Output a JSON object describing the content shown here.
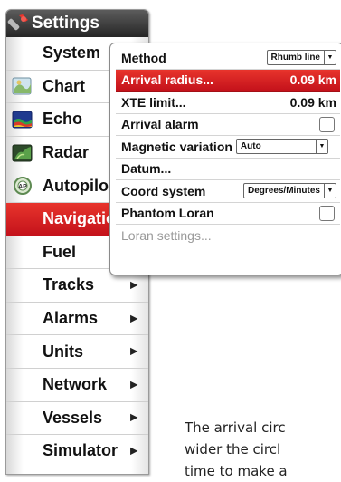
{
  "menu": {
    "header": "Settings",
    "header_icon": "wrench-icon",
    "items": [
      {
        "label": "System",
        "icon": "none",
        "arrow": ""
      },
      {
        "label": "Chart",
        "icon": "chart-icon",
        "arrow": ""
      },
      {
        "label": "Echo",
        "icon": "echo-icon",
        "arrow": ""
      },
      {
        "label": "Radar",
        "icon": "radar-icon",
        "arrow": ""
      },
      {
        "label": "Autopilot",
        "icon": "autopilot-icon",
        "arrow": ""
      },
      {
        "label": "Navigation",
        "icon": "none",
        "arrow": "",
        "selected": true
      },
      {
        "label": "Fuel",
        "icon": "none",
        "arrow": ""
      },
      {
        "label": "Tracks",
        "icon": "none",
        "arrow": "▶"
      },
      {
        "label": "Alarms",
        "icon": "none",
        "arrow": "▶"
      },
      {
        "label": "Units",
        "icon": "none",
        "arrow": "▶"
      },
      {
        "label": "Network",
        "icon": "none",
        "arrow": "▶"
      },
      {
        "label": "Vessels",
        "icon": "none",
        "arrow": "▶"
      },
      {
        "label": "Simulator",
        "icon": "none",
        "arrow": "▶"
      }
    ]
  },
  "panel": {
    "method_label": "Method",
    "method_value": "Rhumb line",
    "arrival_radius_label": "Arrival radius...",
    "arrival_radius_value": "0.09 km",
    "xte_label": "XTE limit...",
    "xte_value": "0.09 km",
    "arrival_alarm_label": "Arrival alarm",
    "magvar_label": "Magnetic variation",
    "magvar_value": "Auto",
    "datum_label": "Datum...",
    "coord_label": "Coord system",
    "coord_value": "Degrees/Minutes",
    "phantom_label": "Phantom Loran",
    "loran_label": "Loran settings..."
  },
  "body_text": {
    "line1": "The arrival circ",
    "line2": "wider the circl",
    "line3": "time to make a"
  },
  "colors": {
    "accent_red": "#d41f26",
    "header_dark": "#333333"
  }
}
